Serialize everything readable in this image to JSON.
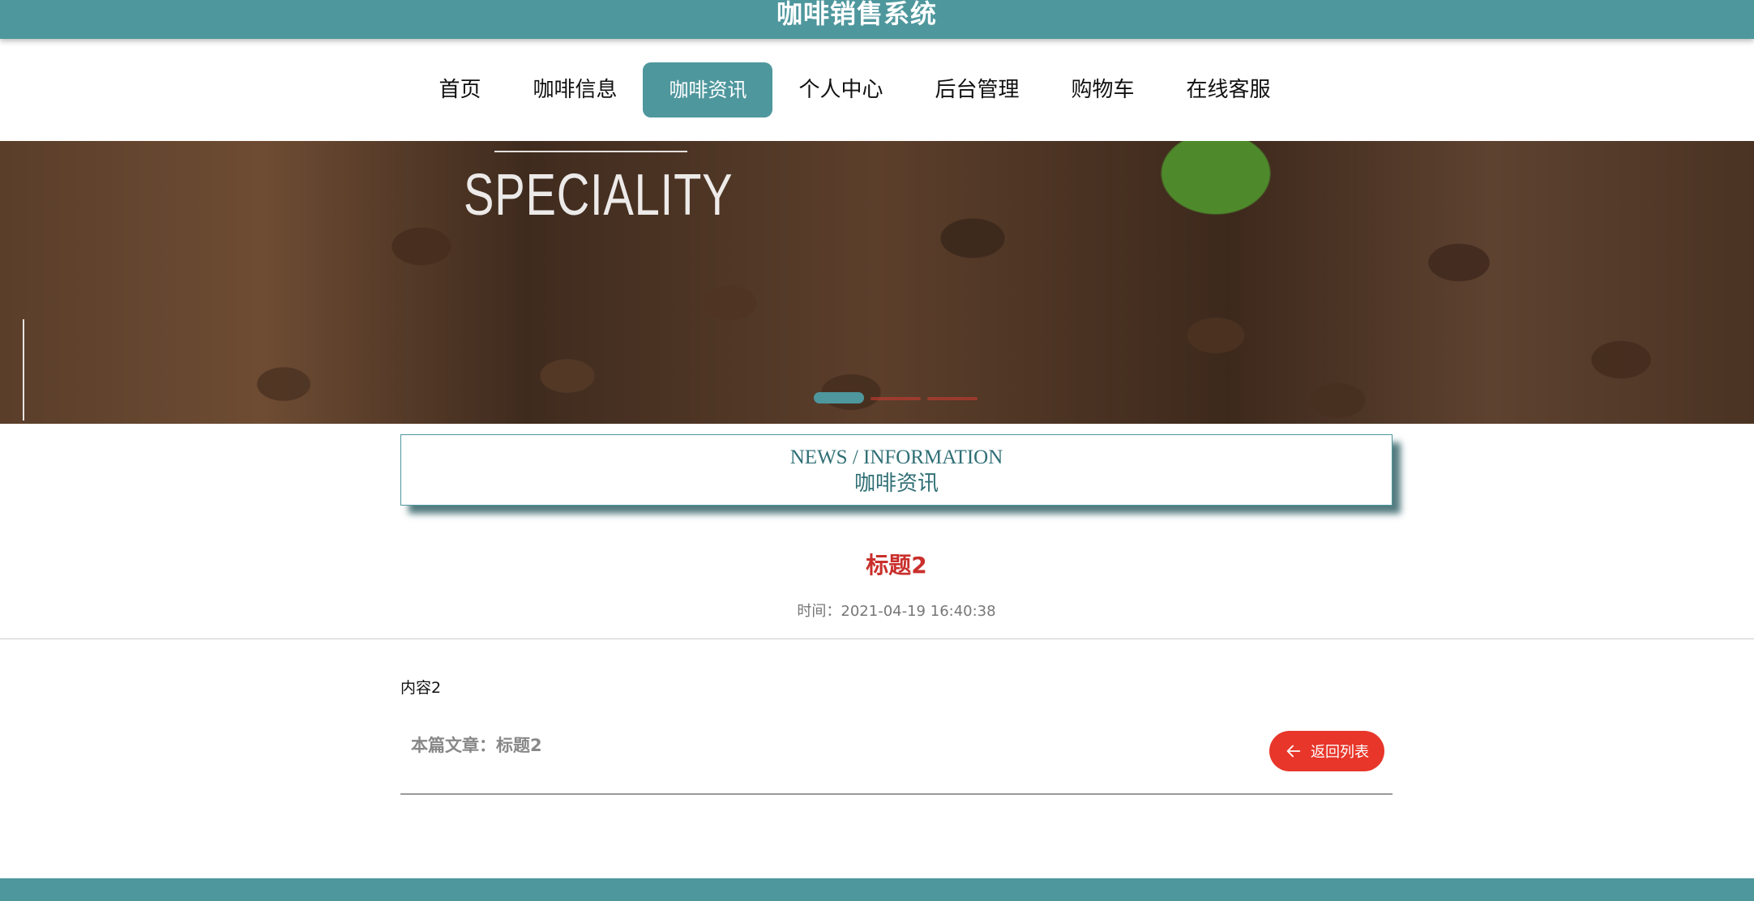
{
  "site": {
    "title": "咖啡销售系统"
  },
  "nav": {
    "items": [
      {
        "label": "首页"
      },
      {
        "label": "咖啡信息"
      },
      {
        "label": "咖啡资讯"
      },
      {
        "label": "个人中心"
      },
      {
        "label": "后台管理"
      },
      {
        "label": "购物车"
      },
      {
        "label": "在线客服"
      }
    ],
    "active_index": 2
  },
  "banner": {
    "text": "SPECIALITY",
    "slide_count": 3,
    "active_slide": 1
  },
  "section": {
    "title_en": "NEWS / INFORMATION",
    "title_cn": "咖啡资讯"
  },
  "article": {
    "title": "标题2",
    "time_label": "时间：",
    "time": "2021-04-19 16:40:38",
    "content": "内容2",
    "current_label": "本篇文章：",
    "current_title": "标题2"
  },
  "actions": {
    "back_label": "返回列表"
  },
  "colors": {
    "primary": "#4e979d",
    "accent_red": "#e8362a",
    "title_red": "#c9302c"
  }
}
